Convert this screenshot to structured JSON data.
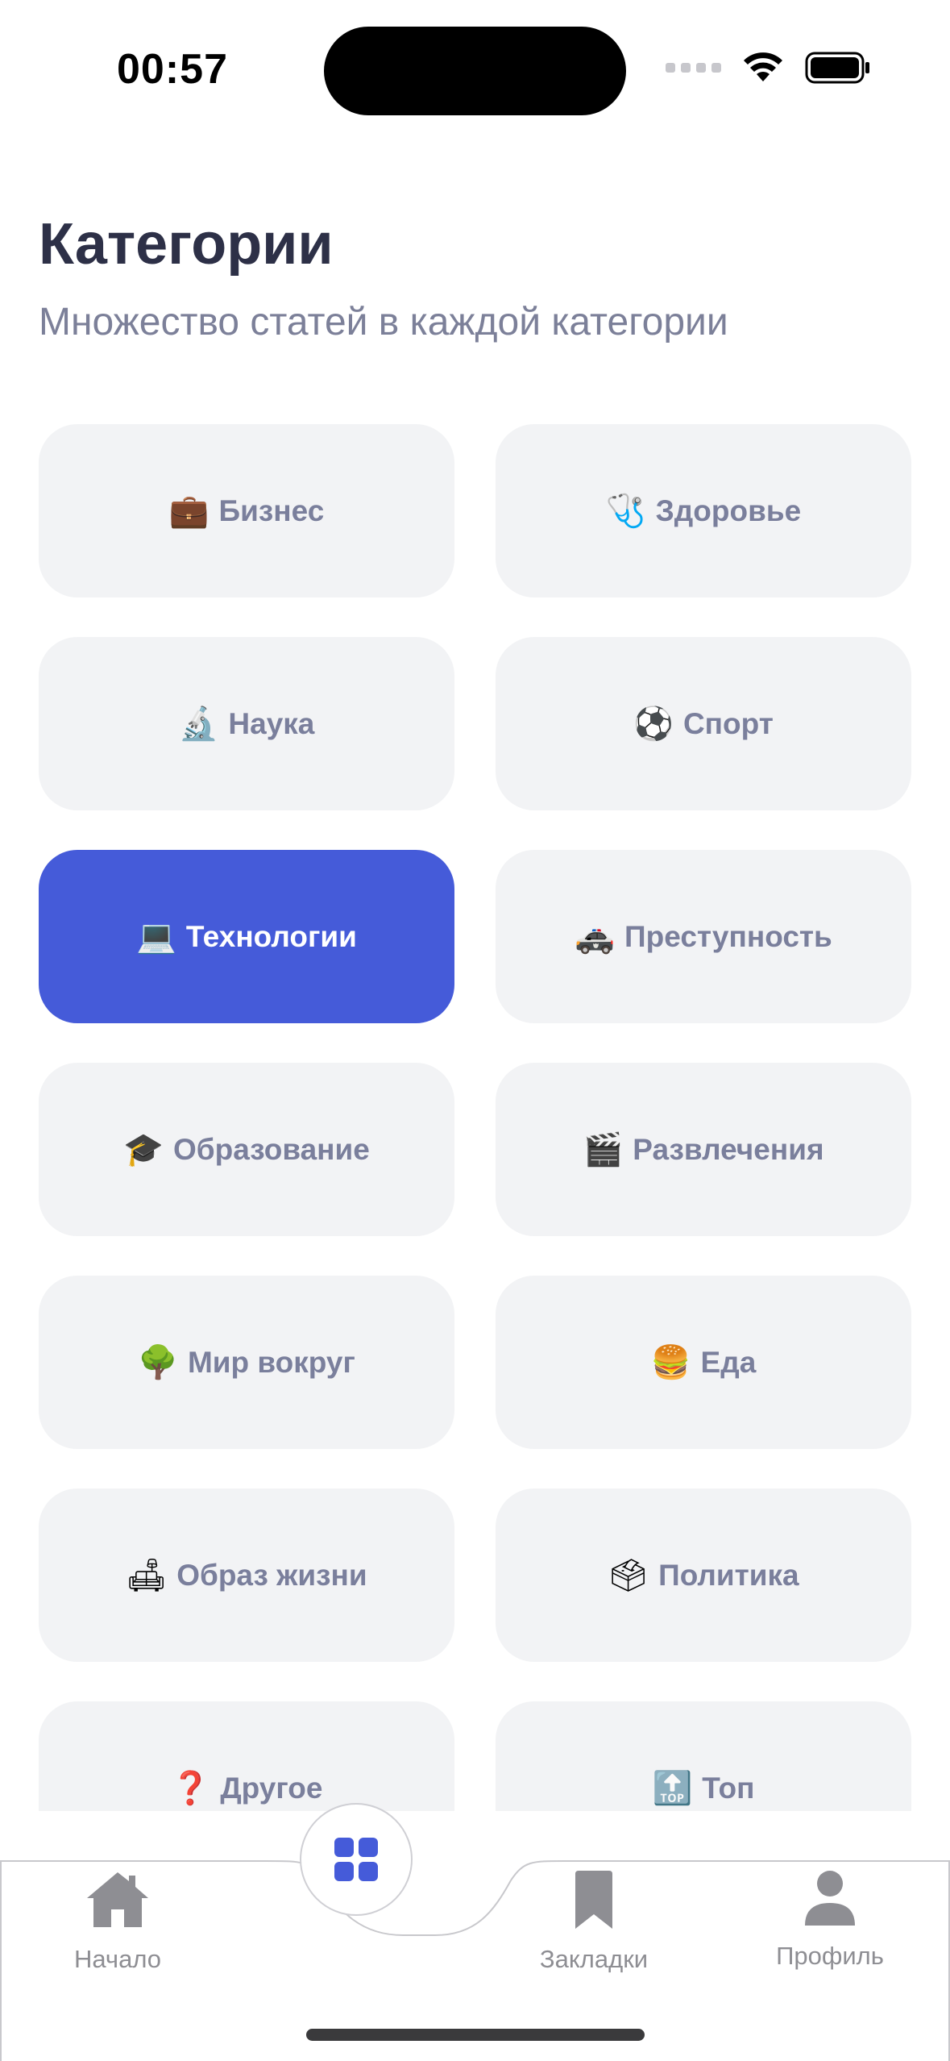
{
  "status_bar": {
    "time": "00:57",
    "icons": [
      "signal-dots-icon",
      "wifi-icon",
      "battery-icon"
    ]
  },
  "header": {
    "title": "Категории",
    "subtitle": "Множество статей в каждой категории"
  },
  "categories": [
    {
      "emoji": "💼",
      "label": "Бизнес",
      "active": false
    },
    {
      "emoji": "🩺",
      "label": "Здоровье",
      "active": false
    },
    {
      "emoji": "🔬",
      "label": "Наука",
      "active": false
    },
    {
      "emoji": "⚽",
      "label": "Спорт",
      "active": false
    },
    {
      "emoji": "💻",
      "label": "Технологии",
      "active": true
    },
    {
      "emoji": "🚓",
      "label": "Преступность",
      "active": false
    },
    {
      "emoji": "🎓",
      "label": "Образование",
      "active": false
    },
    {
      "emoji": "🎬",
      "label": "Развлечения",
      "active": false
    },
    {
      "emoji": "🌳",
      "label": "Мир вокруг",
      "active": false
    },
    {
      "emoji": "🍔",
      "label": "Еда",
      "active": false
    },
    {
      "emoji": "🛋",
      "label": "Образ жизни",
      "active": false
    },
    {
      "emoji": "🗳",
      "label": "Политика",
      "active": false
    },
    {
      "emoji": "❓",
      "label": "Другое",
      "active": false
    },
    {
      "emoji": "🔝",
      "label": "Топ",
      "active": false
    }
  ],
  "tab_bar": {
    "home_label": "Начало",
    "bookmarks_label": "Закладки",
    "profile_label": "Профиль",
    "center_icon": "grid-icon"
  },
  "colors": {
    "accent": "#455bd9",
    "card_bg": "#f2f3f5",
    "title": "#2d3047",
    "muted": "#7c8099",
    "tab_icon": "#8e8e93"
  }
}
